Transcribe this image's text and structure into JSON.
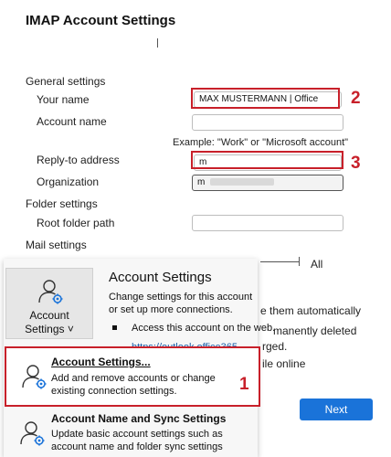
{
  "dialog": {
    "title": "IMAP Account Settings",
    "general_settings": "General settings",
    "your_name_label": "Your name",
    "your_name_value": "MAX MUSTERMANN | Office",
    "account_name_label": "Account name",
    "account_name_value": "",
    "example_hint": "Example: \"Work\" or \"Microsoft account\"",
    "reply_to_label": "Reply-to address",
    "reply_to_value": "m",
    "organization_label": "Organization",
    "organization_value": "m",
    "folder_settings": "Folder settings",
    "root_folder_label": "Root folder path",
    "root_folder_value": "",
    "mail_settings": "Mail settings",
    "slider_value_label": "All",
    "bg_text_1": "e them automatically",
    "bg_text_2": "manently deleted",
    "bg_text_3": "rged.",
    "bg_text_4": "ile online",
    "next_label": "Next"
  },
  "dropdown": {
    "button_label_line1": "Account",
    "button_label_line2": "Settings ˅",
    "header_title": "Account Settings",
    "header_desc": "Change settings for this account or set up more connections.",
    "bullet_text": "Access this account on the web.",
    "bullet_link": "https://outlook.office365",
    "items": [
      {
        "title": "Account Settings...",
        "desc": "Add and remove accounts or change existing connection settings."
      },
      {
        "title": "Account Name and Sync Settings",
        "desc": "Update basic account settings such as account name and folder sync settings"
      }
    ]
  },
  "annotations": {
    "num1": "1",
    "num2": "2",
    "num3": "3",
    "color": "#c8202a"
  }
}
